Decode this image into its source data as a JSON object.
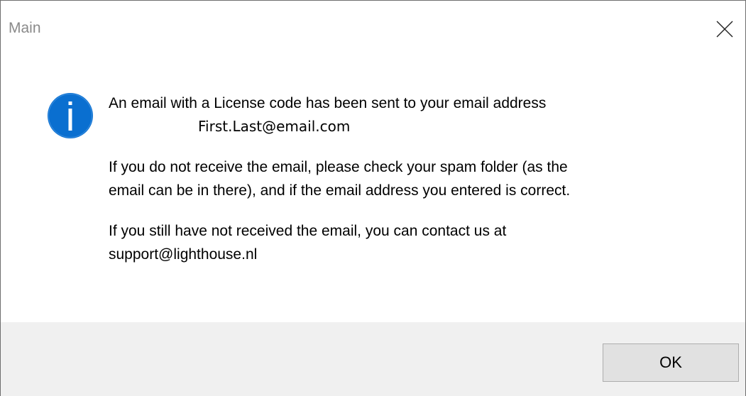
{
  "window": {
    "title": "Main"
  },
  "icon": {
    "name": "info-icon",
    "color": "#0a6fd0"
  },
  "message": {
    "line1": "An email with a License code has been sent to your email address",
    "email": "First.Last@email.com",
    "paragraph2_line1": "If you do not receive the email, please check your spam folder (as the",
    "paragraph2_line2": "email can be in there), and if the email address you entered is correct.",
    "paragraph3_line1": "If you still have not received the email, you can contact us at",
    "paragraph3_line2": "support@lighthouse.nl"
  },
  "buttons": {
    "ok_label": "OK"
  }
}
